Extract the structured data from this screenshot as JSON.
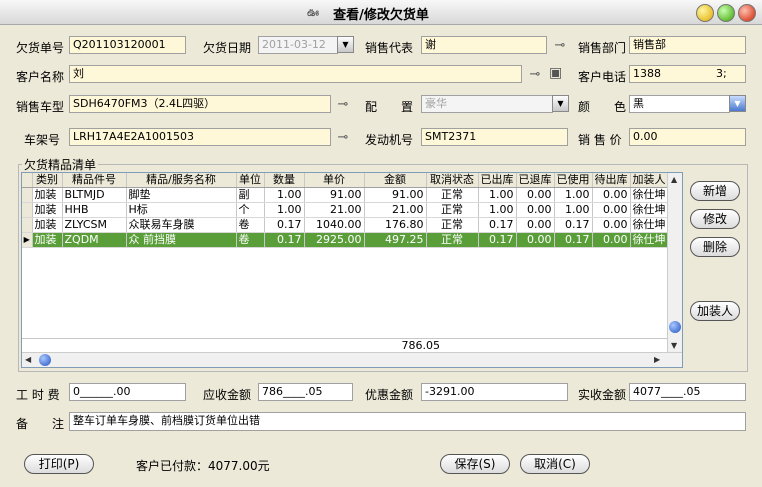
{
  "window": {
    "title": "查看/修改欠货单"
  },
  "form": {
    "order_no_label": "欠货单号",
    "order_no": "Q201103120001",
    "date_label": "欠货日期",
    "date": "2011-03-12",
    "rep_label": "销售代表",
    "rep": "谢",
    "dept_label": "销售部门",
    "dept": "销售部",
    "customer_label": "客户名称",
    "customer": "刘",
    "phone_label": "客户电话",
    "phone": "1388　　　　　3;",
    "model_label": "销售车型",
    "model": "SDH6470FM3（2.4L四驱）",
    "config_label": "配　　置",
    "config": "豪华",
    "color_label": "颜　　色",
    "color": "黑",
    "frame_label": "车架号",
    "frame": "LRH17A4E2A1001503",
    "engine_label": "发动机号",
    "engine": "SMT2371",
    "price_label": "销 售 价",
    "price": "0.00"
  },
  "grid": {
    "title": "欠货精品清单",
    "headers": [
      "类别",
      "精品件号",
      "精品/服务名称",
      "单位",
      "数量",
      "单价",
      "金额",
      "取消状态",
      "已出库",
      "已退库",
      "已使用",
      "待出库",
      "加装人"
    ],
    "rows": [
      [
        "加装",
        "BLTMJD",
        "脚垫",
        "副",
        "1.00",
        "91.00",
        "91.00",
        "正常",
        "1.00",
        "0.00",
        "1.00",
        "0.00",
        "徐仕坤"
      ],
      [
        "加装",
        "HHB",
        "H标",
        "个",
        "1.00",
        "21.00",
        "21.00",
        "正常",
        "1.00",
        "0.00",
        "1.00",
        "0.00",
        "徐仕坤"
      ],
      [
        "加装",
        "ZLYCSM",
        "众联易车身膜",
        "卷",
        "0.17",
        "1040.00",
        "176.80",
        "正常",
        "0.17",
        "0.00",
        "0.17",
        "0.00",
        "徐仕坤"
      ],
      [
        "加装",
        "ZQDM",
        "众 前挡膜",
        "卷",
        "0.17",
        "2925.00",
        "497.25",
        "正常",
        "0.17",
        "0.00",
        "0.17",
        "0.00",
        "徐仕坤"
      ]
    ],
    "total": "786.05"
  },
  "side_buttons": {
    "add": "新增",
    "edit": "修改",
    "delete": "删除",
    "installer": "加装人"
  },
  "footer": {
    "labor_label": "工 时 费",
    "labor": "0______.00",
    "receivable_label": "应收金额",
    "receivable": "786____.05",
    "discount_label": "优惠金额",
    "discount": "-3291.00",
    "received_label": "实收金额",
    "received": "4077____.05",
    "note_label": "备　　注",
    "note": "整车订单车身膜、前档膜订货单位出错"
  },
  "bottom": {
    "print": "打印(P)",
    "paid_text": "客户已付款：4077.00元",
    "save": "保存(S)",
    "cancel": "取消(C)"
  },
  "icons": [
    "window-icon",
    "pin-icon",
    "dropdown-arrow-icon",
    "lookup-icon",
    "row-pointer-icon"
  ]
}
